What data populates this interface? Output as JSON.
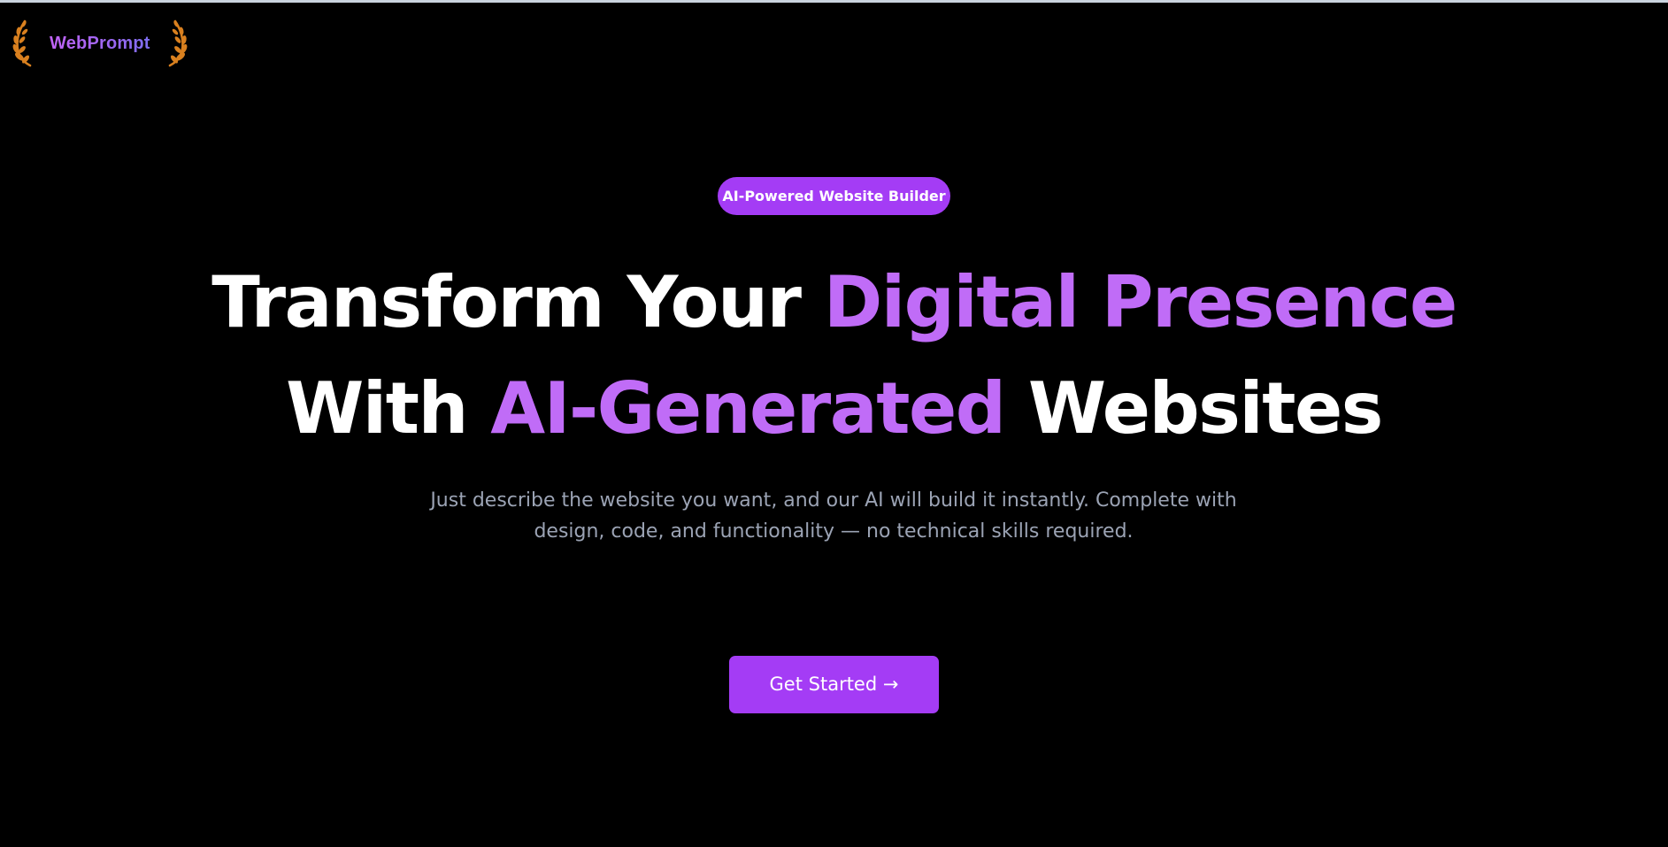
{
  "brand": {
    "name": "WebPrompt",
    "logo_icon": "laurel-wreath-icon",
    "gradient": [
      "#c163f5",
      "#7c6ef0"
    ],
    "laurel_color": "#d9801f"
  },
  "hero": {
    "badge": "AI-Powered Website Builder",
    "headline": {
      "line1_white": "Transform Your ",
      "line1_accent": "Digital Presence",
      "line2_white_a": "With ",
      "line2_accent": "AI-Generated",
      "line2_white_b": " Websites"
    },
    "subtitle_line1": "Just describe the website you want, and our AI will build it instantly. Complete with",
    "subtitle_line2": "design, code, and functionality — no technical skills required.",
    "cta_label": "Get Started →"
  },
  "colors": {
    "background": "#000000",
    "accent": "#a43cf5",
    "accent_text": "#c06cf7",
    "subtitle": "#9ba3b4"
  }
}
